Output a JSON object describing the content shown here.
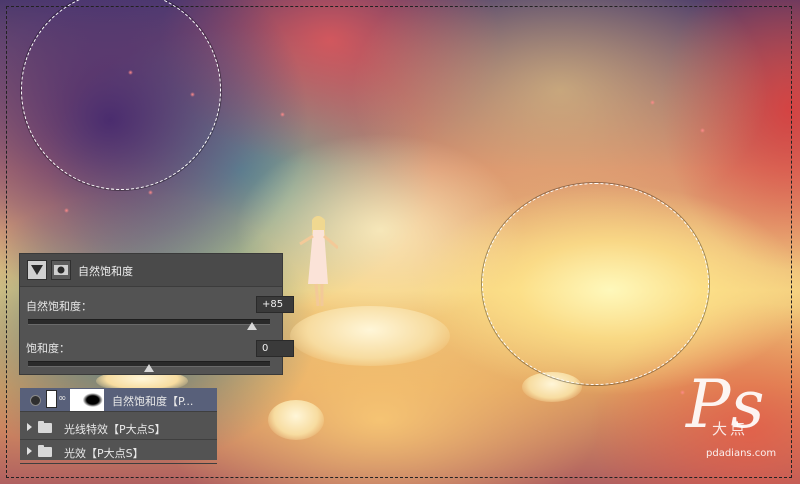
{
  "properties_panel": {
    "title": "自然饱和度",
    "icons": [
      "adjustment-triangle-icon",
      "mask-icon"
    ],
    "vibrance_label": "自然饱和度：",
    "vibrance_value": "+85",
    "vibrance_level": 0.925,
    "saturation_label": "饱和度：",
    "saturation_value": "0",
    "saturation_level": 0.5
  },
  "layers_panel": {
    "layers": [
      {
        "name": "自然饱和度【P...",
        "type": "adjustment",
        "active": true,
        "visible": true
      },
      {
        "name": "光线特效【P大点S】",
        "type": "group",
        "active": false
      },
      {
        "name": "光效【P大点S】",
        "type": "group",
        "active": false
      }
    ]
  },
  "watermark": {
    "logo": "Ps",
    "text": "大点",
    "url": "pdadians.com"
  },
  "colors": {
    "panel_bg": "#535353",
    "active_layer": "#58607a",
    "selection": "#ffffff"
  }
}
